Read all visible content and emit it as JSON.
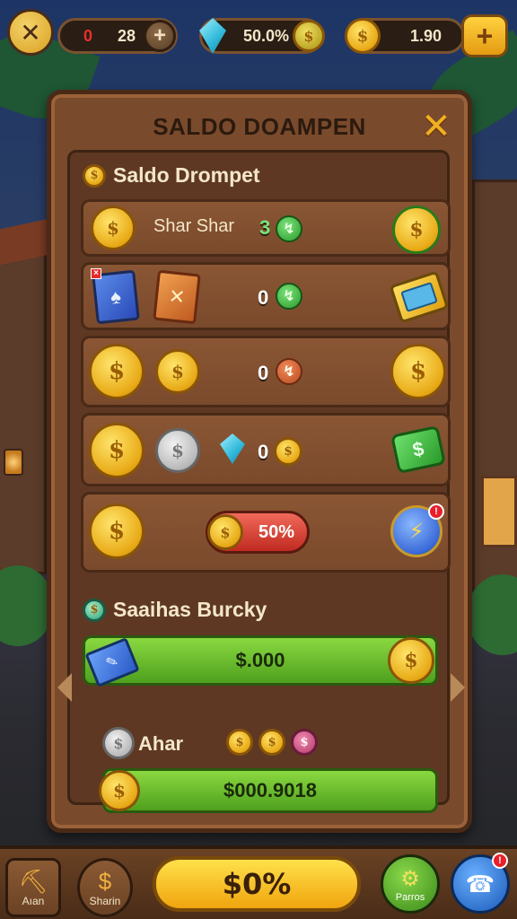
{
  "hud": {
    "close_icon": "x-icon",
    "lives_value": "0",
    "lives_count": "28",
    "gem_value": "50.0%",
    "coin_value": "1.90",
    "plus_label": "+",
    "add_label": "+"
  },
  "panel": {
    "title": "SALDO DOAMPEN",
    "close_label": "✕"
  },
  "section1": {
    "title": "Saldo Drompet",
    "rows": [
      {
        "label": "Shar Shar",
        "value": "3"
      },
      {
        "value": "0"
      },
      {
        "value": "0"
      },
      {
        "value": "0"
      },
      {
        "pill_value": "50%"
      }
    ]
  },
  "section2": {
    "title": "Saaihas Burcky",
    "bar_value": "$.000",
    "sub_label": "Ahar",
    "bar2_value": "$000.9018"
  },
  "bottom": {
    "tab1_label": "Aıan",
    "tab2_label": "Sharin",
    "cta_label": "$0%",
    "tab4_label": "Parros"
  },
  "colors": {
    "accent": "#f0a40e",
    "panel": "#7a4a2c",
    "green": "#4fa01e",
    "red": "#c02a20"
  }
}
